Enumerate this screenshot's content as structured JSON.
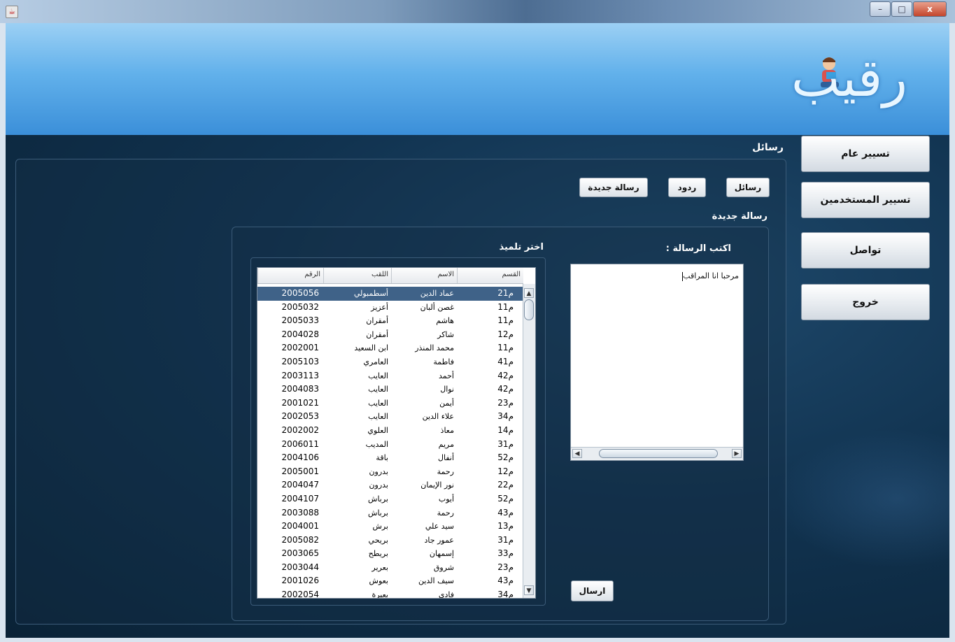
{
  "window": {
    "title": "",
    "controls": {
      "minimize": "–",
      "maximize": "□",
      "close": "x"
    }
  },
  "banner": {
    "logo_text": "رقيب"
  },
  "nav": {
    "items": [
      {
        "label": "تسيير عام"
      },
      {
        "label": "تسيير المستخدمين"
      },
      {
        "label": "تواصل"
      },
      {
        "label": "خروج"
      }
    ]
  },
  "messages": {
    "section_title": "رسائل",
    "tabs": {
      "messages": "رسائل",
      "replies": "ردود",
      "new_message": "رسالة جديدة"
    },
    "new_message_title": "رسالة جديدة",
    "write_label": "اكتب الرسالة :",
    "message_text": "مرحبا انا المراقب",
    "choose_student_label": "اختر تلميذ",
    "send_label": "ارسال"
  },
  "students_table": {
    "columns": [
      "القسم",
      "الاسم",
      "اللقب",
      "الرقم"
    ],
    "selected_index": 0,
    "rows": [
      [
        "2م1",
        "عماد الدين",
        "أسطمبولي",
        "2005056"
      ],
      [
        "1م1",
        "غصن ألبان",
        "أعزيز",
        "2005032"
      ],
      [
        "1م1",
        "هاشم",
        "أمقران",
        "2005033"
      ],
      [
        "1م2",
        "شاكر",
        "أمقران",
        "2004028"
      ],
      [
        "1م1",
        "محمد المنذر",
        "ابن السعيد",
        "2002001"
      ],
      [
        "4م1",
        "فاطمة",
        "العامري",
        "2005103"
      ],
      [
        "4م2",
        "أحمد",
        "العايب",
        "2003113"
      ],
      [
        "4م2",
        "نوال",
        "العايب",
        "2004083"
      ],
      [
        "2م3",
        "أيمن",
        "العايب",
        "2001021"
      ],
      [
        "3م4",
        "علاء الدين",
        "العايب",
        "2002053"
      ],
      [
        "1م4",
        "معاذ",
        "العلوي",
        "2002002"
      ],
      [
        "3م1",
        "مريم",
        "المديب",
        "2006011"
      ],
      [
        "5م2",
        "أنفال",
        "باقة",
        "2004106"
      ],
      [
        "1م2",
        "رحمة",
        "بدرون",
        "2005001"
      ],
      [
        "2م2",
        "نور الإيمان",
        "بدرون",
        "2004047"
      ],
      [
        "5م2",
        "أيوب",
        "برباش",
        "2004107"
      ],
      [
        "4م3",
        "رحمة",
        "برباش",
        "2003088"
      ],
      [
        "1م3",
        "سيد علي",
        "برش",
        "2004001"
      ],
      [
        "3م1",
        "عمور جاد",
        "بريحي",
        "2005082"
      ],
      [
        "3م3",
        "إسمهان",
        "بريطح",
        "2003065"
      ],
      [
        "2م3",
        "شروق",
        "بعرير",
        "2003044"
      ],
      [
        "4م3",
        "سيف الدين",
        "بعوش",
        "2001026"
      ],
      [
        "3م4",
        "فادي",
        "بعيرة",
        "2002054"
      ]
    ]
  }
}
